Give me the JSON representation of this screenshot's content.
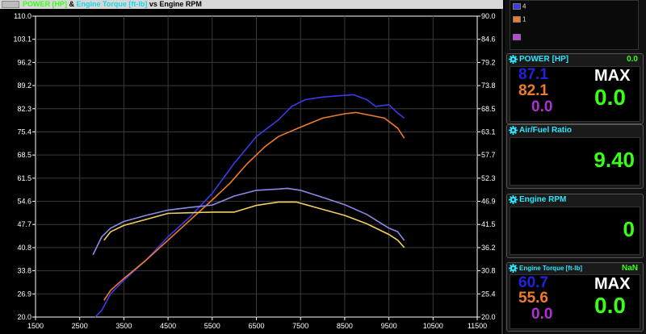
{
  "window": {
    "title_parts": [
      {
        "text": "POWER [HP]",
        "color": "#39ff14"
      },
      {
        "text": " & ",
        "color": "#000000"
      },
      {
        "text": "Engine Torque [ft-lb]",
        "color": "#19d6e6"
      },
      {
        "text": " vs Engine RPM",
        "color": "#000000"
      }
    ]
  },
  "chart_data": {
    "type": "line",
    "x": {
      "label": "",
      "min": 1500,
      "max": 11500,
      "ticks": [
        "1500",
        "2500",
        "3500",
        "4500",
        "5500",
        "6500",
        "7500",
        "8500",
        "9500",
        "10500",
        "11500"
      ]
    },
    "y_left": {
      "min": 20.0,
      "max": 110.0,
      "ticks": [
        "20.0",
        "26.9",
        "33.8",
        "40.8",
        "47.7",
        "54.6",
        "61.5",
        "68.5",
        "75.4",
        "82.3",
        "89.2",
        "96.2",
        "103.1",
        "110.0"
      ]
    },
    "y_right": {
      "min": 20.0,
      "max": 90.0,
      "ticks": [
        "20.0",
        "25.4",
        "30.8",
        "36.2",
        "41.5",
        "46.9",
        "52.3",
        "57.7",
        "63.1",
        "68.5",
        "73.8",
        "79.2",
        "84.6",
        "90.0"
      ]
    },
    "grid": true,
    "series": [
      {
        "name": "4",
        "kind": "power",
        "color": "#3a3ae8",
        "points": [
          [
            2850,
            20.0
          ],
          [
            3000,
            22
          ],
          [
            3200,
            27
          ],
          [
            3500,
            31
          ],
          [
            4000,
            37
          ],
          [
            4500,
            44
          ],
          [
            5000,
            50
          ],
          [
            5500,
            57
          ],
          [
            6000,
            66
          ],
          [
            6500,
            74
          ],
          [
            7000,
            79
          ],
          [
            7300,
            83
          ],
          [
            7600,
            85
          ],
          [
            8000,
            85.8
          ],
          [
            8400,
            86.2
          ],
          [
            8700,
            86.5
          ],
          [
            9000,
            85
          ],
          [
            9200,
            83
          ],
          [
            9500,
            83.5
          ],
          [
            9700,
            81
          ],
          [
            9850,
            79.5
          ]
        ]
      },
      {
        "name": "1",
        "kind": "power",
        "color": "#f07b2b",
        "points": [
          [
            3050,
            25
          ],
          [
            3200,
            28
          ],
          [
            3500,
            31.5
          ],
          [
            4000,
            37
          ],
          [
            4500,
            43
          ],
          [
            5000,
            49
          ],
          [
            5500,
            55
          ],
          [
            5900,
            60
          ],
          [
            6300,
            66
          ],
          [
            6700,
            71
          ],
          [
            7000,
            74
          ],
          [
            7500,
            76.8
          ],
          [
            8000,
            79.5
          ],
          [
            8500,
            80.8
          ],
          [
            8750,
            81.2
          ],
          [
            9100,
            80.3
          ],
          [
            9400,
            79.5
          ],
          [
            9700,
            76.5
          ],
          [
            9850,
            73.5
          ]
        ]
      },
      {
        "name": "4",
        "kind": "torque",
        "color": "#8a8ae8",
        "points": [
          [
            2800,
            38.6
          ],
          [
            3000,
            44
          ],
          [
            3200,
            46.6
          ],
          [
            3500,
            48.6
          ],
          [
            4000,
            50.4
          ],
          [
            4500,
            52.0
          ],
          [
            5000,
            52.8
          ],
          [
            5500,
            53.5
          ],
          [
            6000,
            56.2
          ],
          [
            6500,
            57.9
          ],
          [
            7000,
            58.3
          ],
          [
            7200,
            58.5
          ],
          [
            7500,
            57.9
          ],
          [
            8000,
            55.8
          ],
          [
            8500,
            53.6
          ],
          [
            9000,
            50.7
          ],
          [
            9500,
            46.6
          ],
          [
            9700,
            45.5
          ],
          [
            9850,
            42.9
          ]
        ]
      },
      {
        "name": "1",
        "kind": "torque",
        "color": "#f0d060",
        "points": [
          [
            3050,
            43
          ],
          [
            3200,
            45.5
          ],
          [
            3500,
            47.4
          ],
          [
            4000,
            49.2
          ],
          [
            4500,
            51.0
          ],
          [
            5000,
            51.2
          ],
          [
            5500,
            51.4
          ],
          [
            6000,
            51.4
          ],
          [
            6500,
            53.4
          ],
          [
            7000,
            54.4
          ],
          [
            7400,
            54.4
          ],
          [
            8000,
            52.2
          ],
          [
            8500,
            50.4
          ],
          [
            9000,
            47.9
          ],
          [
            9500,
            44.7
          ],
          [
            9700,
            43.0
          ],
          [
            9850,
            40.8
          ]
        ]
      }
    ]
  },
  "legend": {
    "items": [
      {
        "name": "4",
        "color": "#3a3ae8"
      },
      {
        "name": "1",
        "color": "#f07b2b"
      },
      {
        "name": "",
        "color": "#c040e0"
      }
    ]
  },
  "gauges": {
    "power": {
      "title": "POWER [HP]",
      "corner_value": "0.0",
      "values": [
        "87.1",
        "82.1",
        "0.0"
      ],
      "value_colors": [
        "#2222dd",
        "#f07b2b",
        "#b030d0"
      ],
      "max_label": "MAX",
      "big_value": "0.0"
    },
    "afr": {
      "title": "Air/Fuel Ratio",
      "value": "9.40"
    },
    "rpm": {
      "title": "Engine RPM",
      "value": "0"
    },
    "torque": {
      "title": "Engine Torque [ft-lb]",
      "corner_value": "NaN",
      "values": [
        "60.7",
        "55.6",
        "0.0"
      ],
      "value_colors": [
        "#2222dd",
        "#f07b2b",
        "#b030d0"
      ],
      "max_label": "MAX",
      "big_value": "0.0"
    }
  },
  "colors": {
    "green": "#39ff14",
    "cyan_header": "#28e8ff",
    "axis": "#ffffff",
    "grid": "#3a3a3a"
  }
}
